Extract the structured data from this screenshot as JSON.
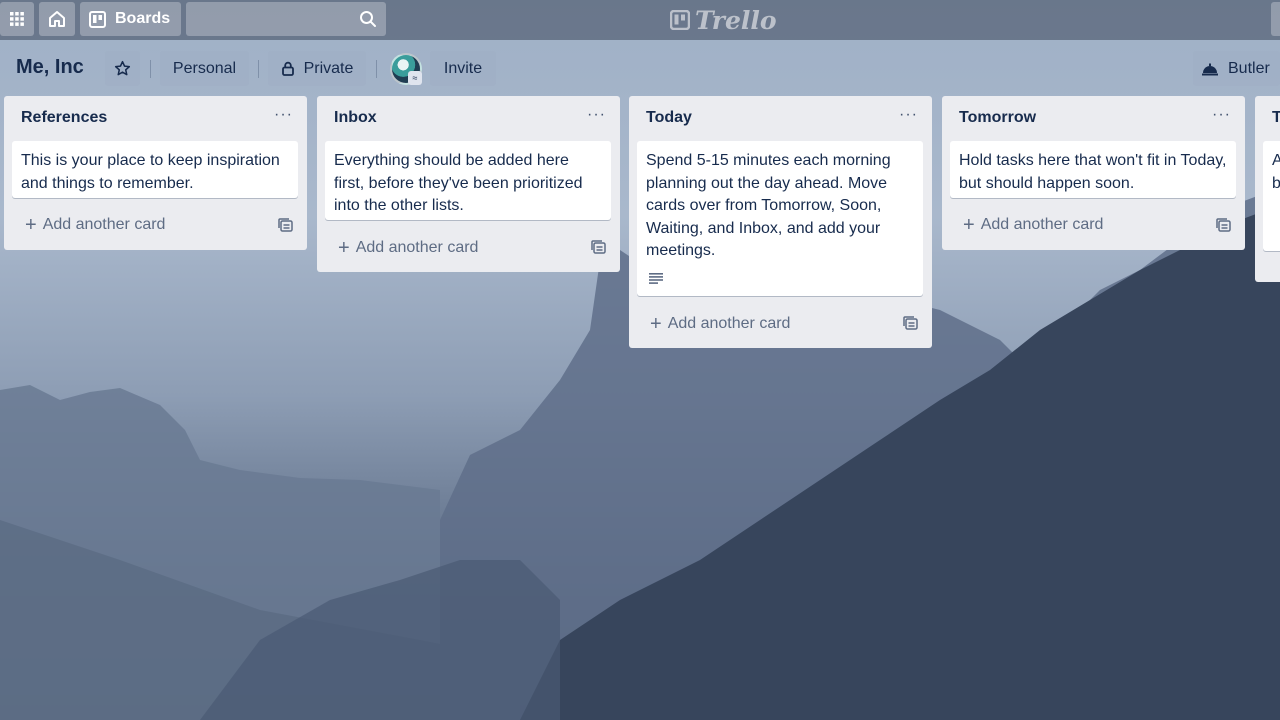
{
  "topbar": {
    "boards_label": "Boards",
    "logo_text": "Trello",
    "search_placeholder": ""
  },
  "board": {
    "title": "Me, Inc",
    "visibility_team": "Personal",
    "visibility_privacy": "Private",
    "invite_label": "Invite",
    "butler_label": "Butler"
  },
  "lists": [
    {
      "title": "References",
      "cards": [
        "This is your place to keep inspiration and things to remember."
      ],
      "add_label": "Add another card"
    },
    {
      "title": "Inbox",
      "cards": [
        "Everything should be added here first, before they've been prioritized into the other lists."
      ],
      "add_label": "Add another card"
    },
    {
      "title": "Today",
      "cards": [
        "Spend 5-15 minutes each morning planning out the day ahead. Move cards over from Tomorrow, Soon, Waiting, and Inbox, and add your meetings."
      ],
      "add_label": "Add another card"
    },
    {
      "title": "Tomorrow",
      "cards": [
        "Hold tasks here that won't fit in Today, but should happen soon."
      ],
      "add_label": "Add another card"
    },
    {
      "title": "T",
      "cards": [
        "A b"
      ],
      "add_label": ""
    }
  ],
  "colors": {
    "list_bg": "#ebecf0",
    "text": "#172b4d",
    "muted": "#5e6c84"
  }
}
